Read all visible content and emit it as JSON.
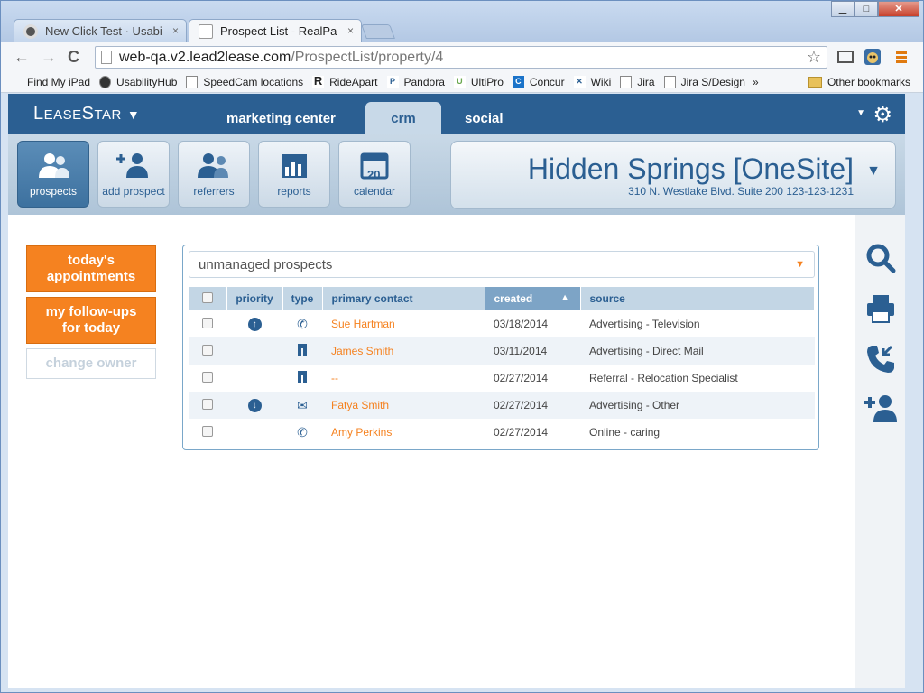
{
  "browser": {
    "tabs": [
      {
        "title": "New Click Test · Usabili",
        "close": "×"
      },
      {
        "title": "Prospect List - RealPage Sc",
        "close": "×"
      }
    ],
    "window_buttons": {
      "minimize": "▁",
      "maximize": "□",
      "close": "✕"
    },
    "address": {
      "host": "web-qa.v2.lead2lease.com",
      "path": "/ProspectList/property/4"
    },
    "nav": {
      "back": "←",
      "forward": "→",
      "reload": "C"
    },
    "bookmarks": [
      {
        "label": "Find My iPad",
        "icon": "apple-icon"
      },
      {
        "label": "UsabilityHub",
        "icon": "usabilityhub-icon"
      },
      {
        "label": "SpeedCam locations",
        "icon": "page-icon"
      },
      {
        "label": "RideApart",
        "icon": "r-icon"
      },
      {
        "label": "Pandora",
        "icon": "p-icon"
      },
      {
        "label": "UltiPro",
        "icon": "u-icon"
      },
      {
        "label": "Concur",
        "icon": "c-icon"
      },
      {
        "label": "Wiki",
        "icon": "x-icon"
      },
      {
        "label": "Jira",
        "icon": "page-icon"
      },
      {
        "label": "Jira S/Design",
        "icon": "page-icon"
      }
    ],
    "bookmarks_more": "»",
    "other_bookmarks": "Other bookmarks"
  },
  "app": {
    "logo": {
      "part1": "L",
      "part2": "EASE",
      "part3": "S",
      "part4": "TAR"
    },
    "topnav": {
      "marketing": "marketing center",
      "crm": "crm",
      "social": "social"
    },
    "quick": [
      {
        "label": "prospects"
      },
      {
        "label": "add prospect"
      },
      {
        "label": "referrers"
      },
      {
        "label": "reports"
      },
      {
        "label": "calendar"
      }
    ],
    "calendar_day": "20",
    "property": {
      "name": "Hidden Springs [OneSite]",
      "address": "310 N. Westlake Blvd. Suite 200 123-123-1231"
    },
    "left_buttons": {
      "appointments_line1": "today's",
      "appointments_line2": "appointments",
      "followups_line1": "my follow-ups",
      "followups_line2": "for today",
      "change_owner": "change owner"
    },
    "filter": {
      "selected": "unmanaged prospects"
    },
    "table": {
      "headers": {
        "priority": "priority",
        "type": "type",
        "contact": "primary contact",
        "created": "created",
        "source": "source"
      },
      "rows": [
        {
          "priority": "up",
          "type": "phone",
          "contact": "Sue Hartman",
          "created": "03/18/2014",
          "source": "Advertising - Television"
        },
        {
          "priority": "",
          "type": "walk-in",
          "contact": "James Smith",
          "created": "03/11/2014",
          "source": "Advertising - Direct Mail"
        },
        {
          "priority": "",
          "type": "walk-in",
          "contact": "--",
          "created": "02/27/2014",
          "source": "Referral - Relocation Specialist"
        },
        {
          "priority": "down",
          "type": "email",
          "contact": "Fatya Smith",
          "created": "02/27/2014",
          "source": "Advertising - Other"
        },
        {
          "priority": "",
          "type": "phone",
          "contact": "Amy Perkins",
          "created": "02/27/2014",
          "source": "Online - caring"
        }
      ]
    }
  },
  "colors": {
    "brand_blue": "#2b5f92",
    "accent_orange": "#f58220"
  }
}
